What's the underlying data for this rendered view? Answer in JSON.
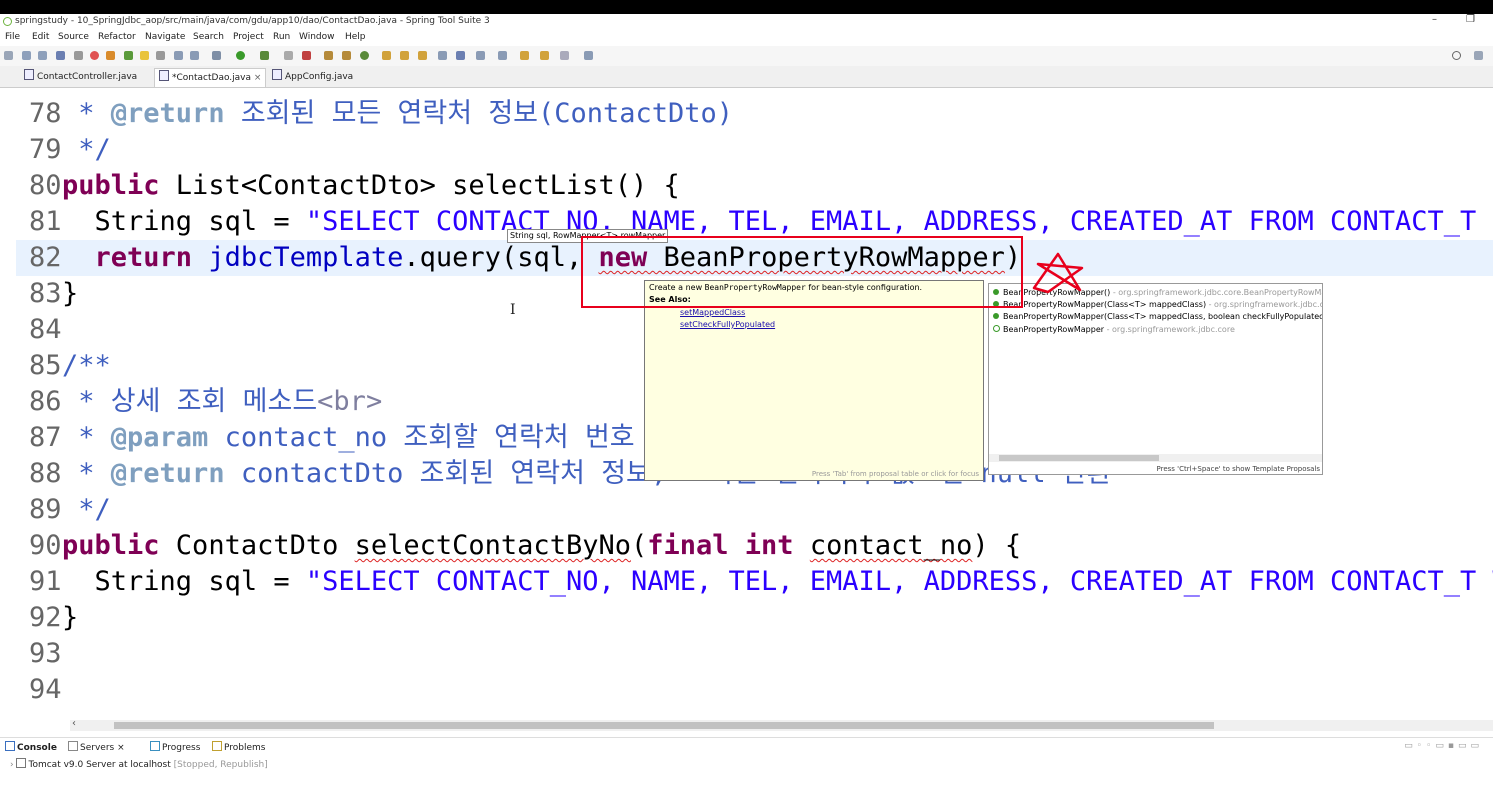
{
  "window": {
    "title": "springstudy - 10_SpringJdbc_aop/src/main/java/com/gdu/app10/dao/ContactDao.java - Spring Tool Suite 3",
    "minimize": "–",
    "restore": "❐"
  },
  "menu": [
    "File",
    "Edit",
    "Source",
    "Refactor",
    "Navigate",
    "Search",
    "Project",
    "Run",
    "Window",
    "Help"
  ],
  "tabs": [
    {
      "label": "ContactController.java"
    },
    {
      "label": "*ContactDao.java",
      "close": "×"
    },
    {
      "label": "AppConfig.java"
    }
  ],
  "editor": {
    "lines": {
      "l78": {
        "no": "78",
        "a": " * ",
        "b": "@return",
        "c": " 조회된 모든 연락처 정보(ContactDto)"
      },
      "l79": {
        "no": "79",
        "a": " */"
      },
      "l80": {
        "no": "80",
        "kw": "public",
        "rest": " List<ContactDto> selectList() {"
      },
      "l81": {
        "no": "81",
        "a": "  String ",
        "b": "sql",
        "c": " = ",
        "d": "\"SELECT CONTACT_NO, NAME, TEL, EMAIL, ADDRESS, CREATED_AT FROM CONTACT_T ORDER BY CONTACT_NO DESC\";"
      },
      "l82": {
        "no": "82",
        "kw": "return",
        "a": " ",
        "b": "jdbcTemplate",
        "c": ".query(",
        "d": "sql",
        "e": ", ",
        "f": "new",
        "g": " BeanPropertyRowMapper",
        "h": ")"
      },
      "l83": {
        "no": "83",
        "a": "}"
      },
      "l84": {
        "no": "84"
      },
      "l85": {
        "no": "85",
        "a": "/**"
      },
      "l86": {
        "no": "86",
        "a": " * 상세 조회 메소드",
        "b": "<br>"
      },
      "l87": {
        "no": "87",
        "a": " * ",
        "b": "@param",
        "c": " contact_no 조회할 연락처 번호"
      },
      "l88": {
        "no": "88",
        "a": " * ",
        "b": "@return",
        "c": " contactDto 조회된 연락처 정보, 조회된 연락처가 없으면 null 반환"
      },
      "l89": {
        "no": "89",
        "a": " */"
      },
      "l90": {
        "no": "90",
        "kw": "public",
        "a": " ContactDto ",
        "b": "selectContactByNo",
        "c": "(",
        "d": "final",
        "e": " ",
        "f": "int",
        "g": " ",
        "h": "contact_no",
        "i": ") {"
      },
      "l91": {
        "no": "91",
        "a": "  String ",
        "b": "sql",
        "c": " = ",
        "d": "\"SELECT CONTACT_NO, NAME, TEL, EMAIL, ADDRESS, CREATED_AT FROM CONTACT_T WHERE CONTACT_NO = ?\";"
      },
      "l92": {
        "no": "92",
        "a": "}"
      },
      "l93": {
        "no": "93"
      },
      "l94": {
        "no": "94"
      }
    }
  },
  "param_hint": "String sql, RowMapper<T> rowMapper",
  "doc_popup": {
    "desc_pre": "Create a new ",
    "desc_code": "BeanPropertyRowMapper",
    "desc_post": " for bean-style configuration.",
    "see_also": "See Also:",
    "links": [
      "setMappedClass",
      "setCheckFullyPopulated"
    ],
    "footer": "Press 'Tab' from proposal table or click for focus"
  },
  "proposals": {
    "items": [
      {
        "name": "BeanPropertyRowMapper()",
        "detail": " - org.springframework.jdbc.core.BeanPropertyRowMapper"
      },
      {
        "name": "BeanPropertyRowMapper(Class<T> mappedClass)",
        "detail": " - org.springframework.jdbc.core"
      },
      {
        "name": "BeanPropertyRowMapper(Class<T> mappedClass, boolean checkFullyPopulated)",
        "detail": ""
      },
      {
        "name": "BeanPropertyRowMapper",
        "detail": " - org.springframework.jdbc.core"
      }
    ],
    "footer": "Press 'Ctrl+Space' to show Template Proposals"
  },
  "bottom": {
    "tabs": [
      "Console",
      "Servers",
      "Progress",
      "Problems"
    ],
    "close": "×",
    "server_label": "Tomcat v9.0 Server at localhost",
    "server_status": "[Stopped, Republish]"
  },
  "colors": {
    "keyword": "#7f0055",
    "string": "#2a00ff",
    "javadoc": "#3f5fbf",
    "annotation_box": "#e8001c"
  }
}
